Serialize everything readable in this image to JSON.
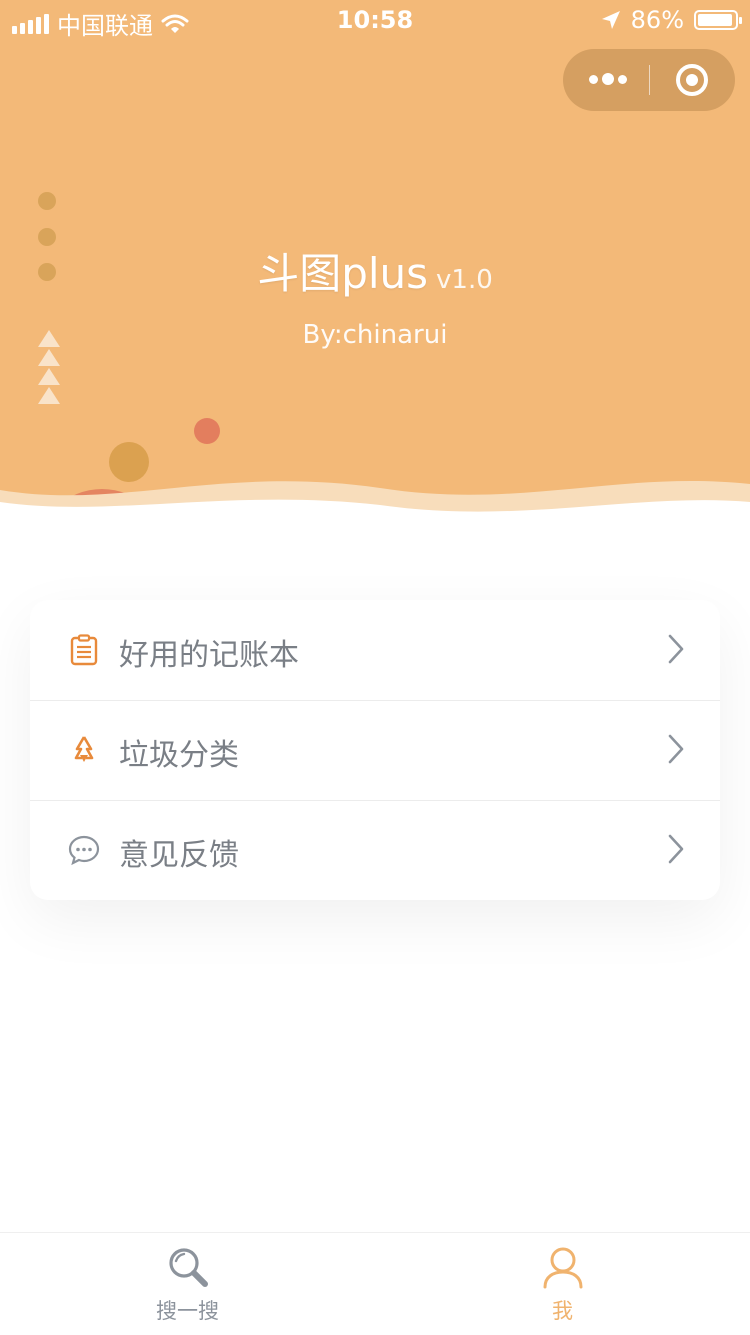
{
  "status_bar": {
    "carrier": "中国联通",
    "time": "10:58",
    "battery": "86%"
  },
  "header": {
    "title": "斗图plus",
    "version": "v1.0",
    "author": "By:chinarui"
  },
  "colors": {
    "header_bg": "#F3B978",
    "accent_orange": "#E88A3B",
    "text_gray": "#7A7F86",
    "tab_active": "#F0B36E",
    "tab_inactive": "#8C939C"
  },
  "menu": {
    "items": [
      {
        "label": "好用的记账本",
        "icon": "clipboard-icon"
      },
      {
        "label": "垃圾分类",
        "icon": "recycle-icon"
      },
      {
        "label": "意见反馈",
        "icon": "chat-icon"
      }
    ]
  },
  "tabbar": {
    "tabs": [
      {
        "label": "搜一搜",
        "icon": "search-icon",
        "active": false
      },
      {
        "label": "我",
        "icon": "user-icon",
        "active": true
      }
    ]
  }
}
